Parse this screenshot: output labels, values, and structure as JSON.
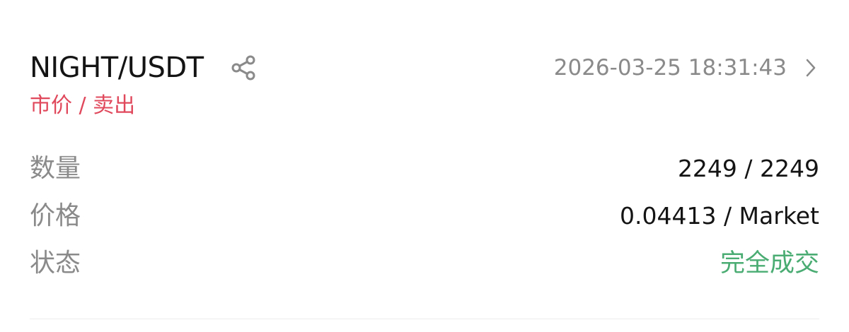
{
  "order": {
    "pair": "NIGHT/USDT",
    "order_type": "市价 / 卖出",
    "timestamp": "2026-03-25 18:31:43",
    "share_icon": "share-icon",
    "chevron_icon": "chevron-right-icon",
    "quantity_label": "数量",
    "quantity_value": "2249 / 2249",
    "price_label": "价格",
    "price_value": "0.04413 / Market",
    "status_label": "状态",
    "status_value": "完全成交"
  },
  "colors": {
    "sell_red": "#e0485c",
    "filled_green": "#4aac72",
    "label_gray": "#8a8a8a",
    "text_dark": "#141414"
  }
}
